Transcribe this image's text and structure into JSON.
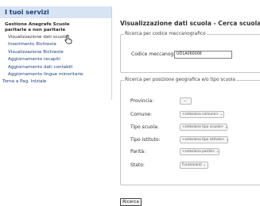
{
  "sidebar": {
    "title": "I tuoi servizi",
    "section_line1": "Gestione Anagrafe Scuole",
    "section_line2": "paritarie e non paritarie",
    "items": [
      {
        "label": "Visualizzazione dati scuola"
      },
      {
        "label": "Inserimento Richiesta"
      },
      {
        "label": "Visualizzazione Richieste"
      },
      {
        "label": "Aggiornamento recapiti"
      },
      {
        "label": "Aggiornamento dati contabili"
      },
      {
        "label": "Aggiornamento lingue minoritarie"
      }
    ],
    "home_link": "Torna a Pag. Iniziale"
  },
  "main": {
    "title": "Visualizzazione dati scuola - Cerca scuola",
    "by_code": {
      "legend": "Ricerca per codice meccanografico",
      "label": "Codice meccanografico:",
      "value": "UD1A060006"
    },
    "by_location": {
      "legend": "Ricerca per posizione geografica e/o tipo scuola",
      "fields": [
        {
          "label": "Provincia:",
          "value": ""
        },
        {
          "label": "Comune:",
          "value": "<seleziona comune>"
        },
        {
          "label": "Tipo scuola:",
          "value": "<seleziona tipo scuola>"
        },
        {
          "label": "Tipo istituto:",
          "value": "<seleziona tipo istituto>"
        },
        {
          "label": "Parità:",
          "value": "<seleziona parità>"
        },
        {
          "label": "Stato:",
          "value": "Funzionanti"
        }
      ]
    },
    "search_button": "Ricerca"
  }
}
